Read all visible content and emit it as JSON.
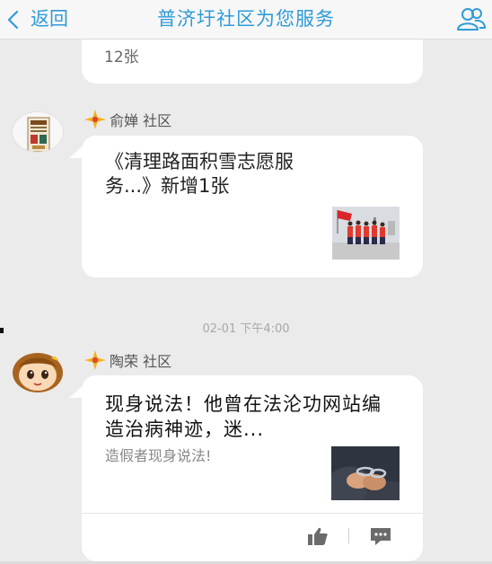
{
  "header": {
    "back_label": "返回",
    "title": "普济圩社区为您服务"
  },
  "feed": {
    "top_card_count": "12张",
    "messages": [
      {
        "sender": "俞婵 社区",
        "headline": "《清理路面积雪志愿服务...》新增1张"
      },
      {
        "sender": "陶荣 社区",
        "headline": "现身说法！他曾在法沦功网站编造治病神迹，迷...",
        "subline": "造假者现身说法!"
      }
    ],
    "timestamp": "02-01 下午4:00"
  },
  "colors": {
    "accent": "#2f9bd8",
    "background": "#ebebeb",
    "card": "#ffffff",
    "star": "#f5b21a"
  },
  "icons": {
    "back": "chevron-left-icon",
    "people": "people-icon",
    "badge": "star-badge-icon",
    "like": "thumbs-up-icon",
    "comment": "comment-icon"
  }
}
